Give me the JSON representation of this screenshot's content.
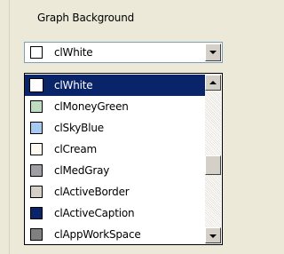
{
  "group_label": "Graph Background",
  "combo": {
    "value": "clWhite",
    "swatch_color": "#ffffff"
  },
  "dropdown": {
    "items": [
      {
        "label": "clWhite",
        "color": "#ffffff",
        "selected": true
      },
      {
        "label": "clMoneyGreen",
        "color": "#c0dcc0",
        "selected": false
      },
      {
        "label": "clSkyBlue",
        "color": "#a6caf0",
        "selected": false
      },
      {
        "label": "clCream",
        "color": "#fffbf0",
        "selected": false
      },
      {
        "label": "clMedGray",
        "color": "#a0a0a4",
        "selected": false
      },
      {
        "label": "clActiveBorder",
        "color": "#d4d0c8",
        "selected": false
      },
      {
        "label": "clActiveCaption",
        "color": "#0a246a",
        "selected": false
      },
      {
        "label": "clAppWorkSpace",
        "color": "#808080",
        "selected": false
      }
    ],
    "selection_color": "#0a246a"
  },
  "scrollbar": {
    "position_fraction": 0.55
  }
}
